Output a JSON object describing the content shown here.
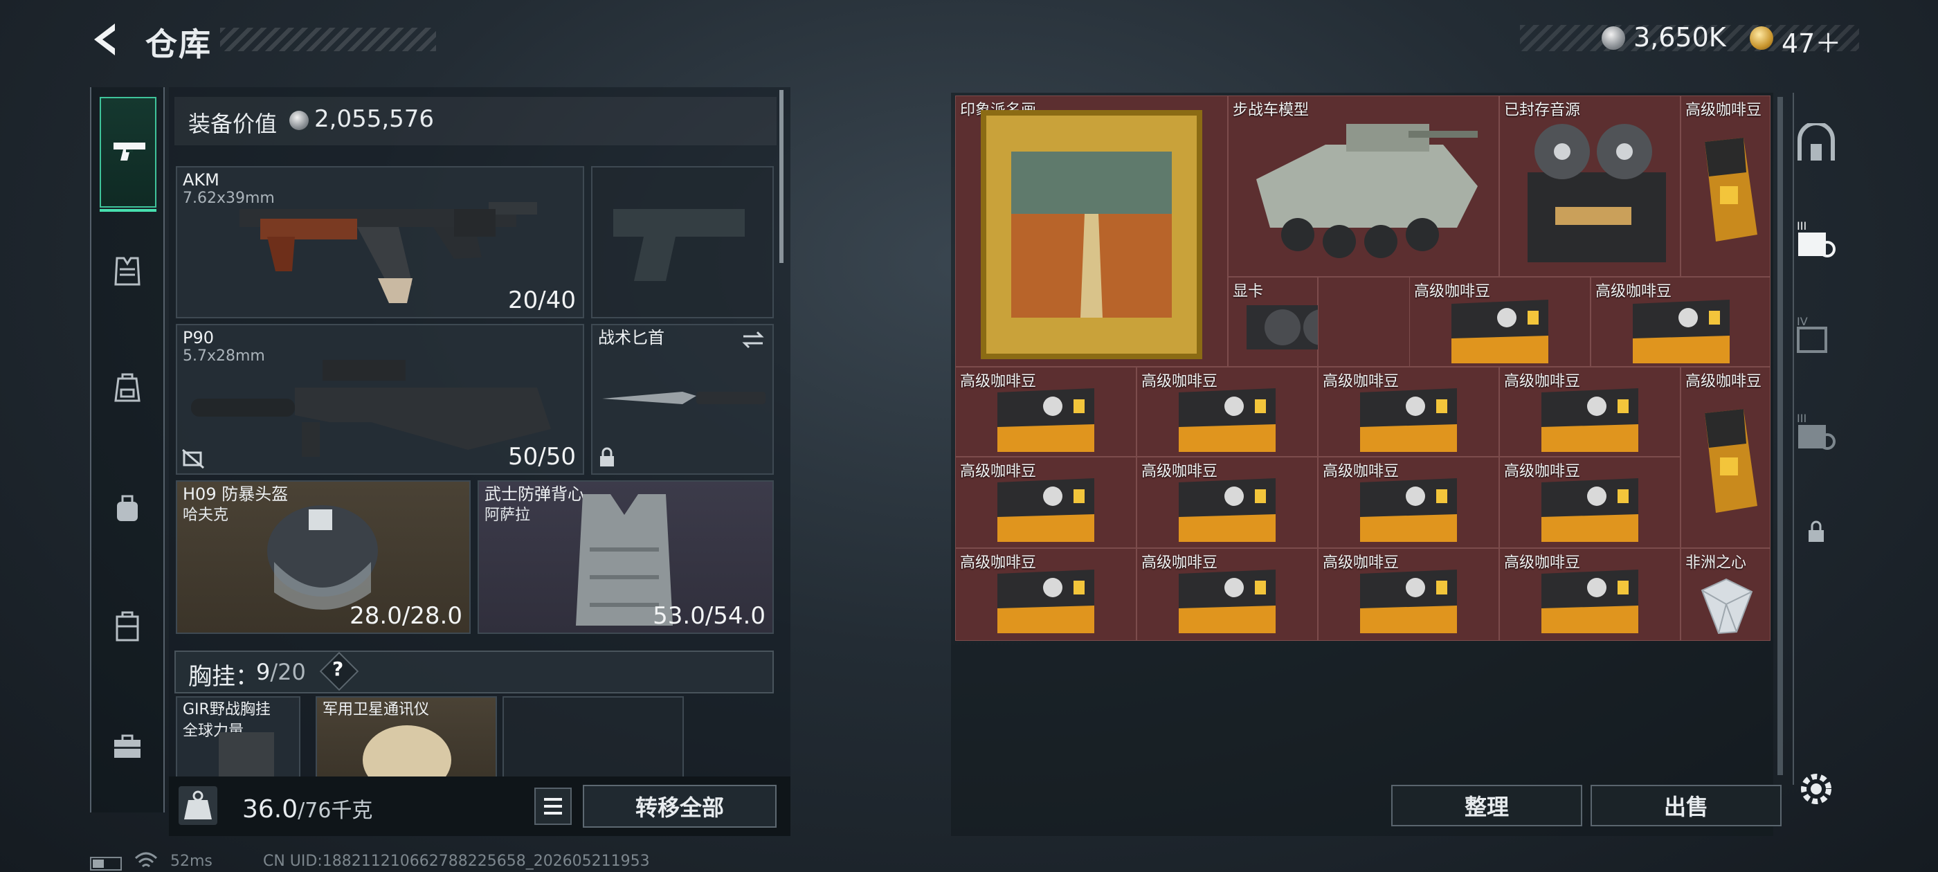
{
  "header": {
    "title": "仓库",
    "currency_silver": "3,650K",
    "currency_gold": "47＋"
  },
  "left_tabs": [
    "pistol-icon",
    "armor-icon",
    "backpack-icon",
    "bag-icon",
    "case-icon",
    "toolbox-icon"
  ],
  "loadout": {
    "equip_value_label": "装备价值",
    "equip_value": "2,055,576",
    "slots": {
      "akm": {
        "name": "AKM",
        "sub": "7.62x39mm",
        "count": "20/40"
      },
      "p90": {
        "name": "P90",
        "sub": "5.7x28mm",
        "count": "50/50"
      },
      "knife": {
        "name": "战术匕首"
      },
      "helmet": {
        "name": "H09 防暴头盔",
        "sub": "哈夫克",
        "count": "28.0/28.0"
      },
      "vest": {
        "name": "武士防弹背心",
        "sub": "阿萨拉",
        "count": "53.0/54.0"
      }
    },
    "chest_rig_label": "胸挂：",
    "chest_rig_count": "9",
    "chest_rig_total": "/20",
    "chest_help": "?",
    "rig_items": [
      {
        "name": "GIR野战胸挂",
        "sub": "全球力量"
      },
      {
        "name": "军用卫星通讯仪"
      }
    ],
    "weight_value": "36.0",
    "weight_total": "/76千克",
    "transfer_all": "转移全部"
  },
  "stash": {
    "items": [
      {
        "name": "印象派名画",
        "type": "painting"
      },
      {
        "name": "步战车模型",
        "type": "ifv"
      },
      {
        "name": "已封存音源",
        "type": "recorder"
      },
      {
        "name": "高级咖啡豆",
        "type": "coffee-bag"
      },
      {
        "name": "显卡",
        "type": "gpu"
      },
      {
        "name": "高级咖啡豆",
        "type": "coffee-pack"
      },
      {
        "name": "高级咖啡豆",
        "type": "coffee-pack"
      },
      {
        "name": "高级咖啡豆",
        "type": "coffee-pack"
      },
      {
        "name": "高级咖啡豆",
        "type": "coffee-pack"
      },
      {
        "name": "高级咖啡豆",
        "type": "coffee-pack"
      },
      {
        "name": "高级咖啡豆",
        "type": "coffee-pack"
      },
      {
        "name": "高级咖啡豆",
        "type": "coffee-bag"
      },
      {
        "name": "高级咖啡豆",
        "type": "coffee-pack"
      },
      {
        "name": "高级咖啡豆",
        "type": "coffee-pack"
      },
      {
        "name": "高级咖啡豆",
        "type": "coffee-pack"
      },
      {
        "name": "高级咖啡豆",
        "type": "coffee-pack"
      },
      {
        "name": "高级咖啡豆",
        "type": "coffee-pack"
      },
      {
        "name": "高级咖啡豆",
        "type": "coffee-pack"
      },
      {
        "name": "高级咖啡豆",
        "type": "coffee-pack"
      },
      {
        "name": "高级咖啡豆",
        "type": "coffee-pack"
      },
      {
        "name": "非洲之心",
        "type": "diamond"
      }
    ],
    "sort_button": "整理",
    "sell_button": "出售"
  },
  "right_tabs": [
    "vault-icon",
    "stash-III-icon",
    "stash-IV-icon",
    "stash-III-alt-icon",
    "lock-icon"
  ],
  "footer": {
    "ping": "52ms",
    "uid": "CN UID:18821121066278822565​8_202605211953"
  }
}
